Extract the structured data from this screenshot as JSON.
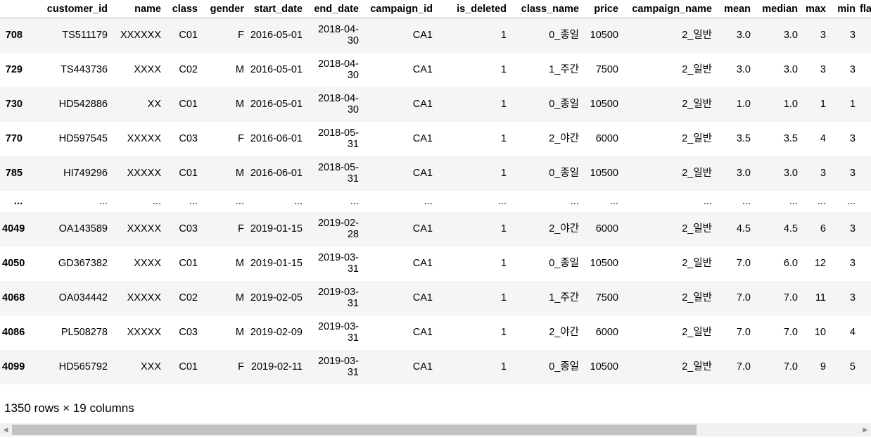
{
  "table": {
    "index_header": "",
    "columns": [
      "customer_id",
      "name",
      "class",
      "gender",
      "start_date",
      "end_date",
      "campaign_id",
      "is_deleted",
      "class_name",
      "price",
      "campaign_name",
      "mean",
      "median",
      "max",
      "min",
      "fla"
    ],
    "rows": [
      {
        "index": "708",
        "cells": [
          "TS511179",
          "XXXXXX",
          "C01",
          "F",
          "2016-05-01",
          "2018-04-30",
          "CA1",
          "1",
          "0_종일",
          "10500",
          "2_일반",
          "3.0",
          "3.0",
          "3",
          "3",
          ""
        ]
      },
      {
        "index": "729",
        "cells": [
          "TS443736",
          "XXXX",
          "C02",
          "M",
          "2016-05-01",
          "2018-04-30",
          "CA1",
          "1",
          "1_주간",
          "7500",
          "2_일반",
          "3.0",
          "3.0",
          "3",
          "3",
          ""
        ]
      },
      {
        "index": "730",
        "cells": [
          "HD542886",
          "XX",
          "C01",
          "M",
          "2016-05-01",
          "2018-04-30",
          "CA1",
          "1",
          "0_종일",
          "10500",
          "2_일반",
          "1.0",
          "1.0",
          "1",
          "1",
          ""
        ]
      },
      {
        "index": "770",
        "cells": [
          "HD597545",
          "XXXXX",
          "C03",
          "F",
          "2016-06-01",
          "2018-05-31",
          "CA1",
          "1",
          "2_야간",
          "6000",
          "2_일반",
          "3.5",
          "3.5",
          "4",
          "3",
          ""
        ]
      },
      {
        "index": "785",
        "cells": [
          "HI749296",
          "XXXXX",
          "C01",
          "M",
          "2016-06-01",
          "2018-05-31",
          "CA1",
          "1",
          "0_종일",
          "10500",
          "2_일반",
          "3.0",
          "3.0",
          "3",
          "3",
          ""
        ]
      },
      {
        "index": "...",
        "cells": [
          "...",
          "...",
          "...",
          "...",
          "...",
          "...",
          "...",
          "...",
          "...",
          "...",
          "...",
          "...",
          "...",
          "...",
          "...",
          ""
        ],
        "ellipsis": true
      },
      {
        "index": "4049",
        "cells": [
          "OA143589",
          "XXXXX",
          "C03",
          "F",
          "2019-01-15",
          "2019-02-28",
          "CA1",
          "1",
          "2_야간",
          "6000",
          "2_일반",
          "4.5",
          "4.5",
          "6",
          "3",
          ""
        ]
      },
      {
        "index": "4050",
        "cells": [
          "GD367382",
          "XXXX",
          "C01",
          "M",
          "2019-01-15",
          "2019-03-31",
          "CA1",
          "1",
          "0_종일",
          "10500",
          "2_일반",
          "7.0",
          "6.0",
          "12",
          "3",
          ""
        ]
      },
      {
        "index": "4068",
        "cells": [
          "OA034442",
          "XXXXX",
          "C02",
          "M",
          "2019-02-05",
          "2019-03-31",
          "CA1",
          "1",
          "1_주간",
          "7500",
          "2_일반",
          "7.0",
          "7.0",
          "11",
          "3",
          ""
        ]
      },
      {
        "index": "4086",
        "cells": [
          "PL508278",
          "XXXXX",
          "C03",
          "M",
          "2019-02-09",
          "2019-03-31",
          "CA1",
          "1",
          "2_야간",
          "6000",
          "2_일반",
          "7.0",
          "7.0",
          "10",
          "4",
          ""
        ]
      },
      {
        "index": "4099",
        "cells": [
          "HD565792",
          "XXX",
          "C01",
          "F",
          "2019-02-11",
          "2019-03-31",
          "CA1",
          "1",
          "0_종일",
          "10500",
          "2_일반",
          "7.0",
          "7.0",
          "9",
          "5",
          ""
        ]
      }
    ]
  },
  "shape_text": "1350 rows × 19 columns",
  "scrollbar": {
    "left_arrow": "◀",
    "right_arrow": "▶"
  },
  "colors": {
    "stripe": "#f5f5f5",
    "scroll_track": "#f1f1f1",
    "scroll_thumb": "#c1c1c1"
  }
}
